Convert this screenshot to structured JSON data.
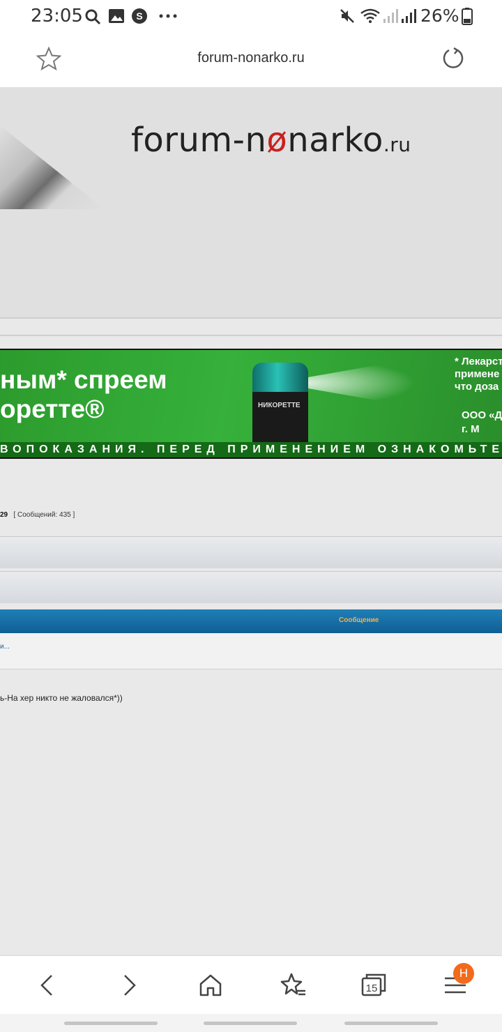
{
  "status_bar": {
    "time": "23:05",
    "battery": "26%",
    "icons": [
      "search-icon",
      "image-icon",
      "skype-icon",
      "more-icon",
      "mute-icon",
      "wifi-icon",
      "signal-icon",
      "battery-icon"
    ]
  },
  "address_bar": {
    "url": "forum-nonarko.ru"
  },
  "site": {
    "logo_left": "forum-n",
    "logo_o": "ø",
    "logo_right": "narko",
    "logo_tld": ".ru"
  },
  "banner": {
    "line1": "ным* спреем",
    "line2": "оретте®",
    "note_top": "* Лекарст\nприменe\nчто доза",
    "note_bottom": "ООО «Д\nг. М",
    "can_label": "НИКОРЕТТЕ",
    "strip_text": "ВОПОКАЗАНИЯ. ПЕРЕД ПРИМЕНЕНИЕМ ОЗНАКОМЬТЕС"
  },
  "post": {
    "number": "29",
    "messages": "[ Сообщений: 435 ]",
    "column_header": "Сообщение",
    "link_fragment": "и...",
    "text": "ь-На хер никто не жаловался*))"
  },
  "bottom_nav": {
    "tabs_count": "15",
    "badge": "H",
    "icons": [
      "back-icon",
      "forward-icon",
      "home-icon",
      "bookmarks-icon",
      "tabs-icon",
      "menu-icon"
    ]
  }
}
